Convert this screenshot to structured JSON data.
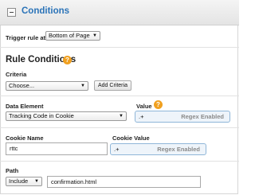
{
  "header": {
    "title": "Conditions"
  },
  "trigger": {
    "label": "Trigger rule at",
    "selected": "Bottom of Page"
  },
  "rule_conditions": {
    "heading": "Rule Conditions"
  },
  "criteria": {
    "label": "Criteria",
    "selected": "Choose...",
    "add_button": "Add Criteria"
  },
  "data_element": {
    "label": "Data Element",
    "selected": "Tracking Code in Cookie"
  },
  "value": {
    "label": "Value",
    "text": ".+",
    "regex_label": "Regex Enabled"
  },
  "cookie_name": {
    "label": "Cookie Name",
    "value": "rttc"
  },
  "cookie_value": {
    "label": "Cookie Value",
    "text": ".+",
    "regex_label": "Regex Enabled"
  },
  "path": {
    "label": "Path",
    "operator": "Include",
    "value": "confirmation.html"
  },
  "colors": {
    "title_blue": "#2a73b8",
    "help_orange": "#f0a020",
    "regex_bg": "#eef4fa",
    "regex_border": "#8fb6d8"
  }
}
